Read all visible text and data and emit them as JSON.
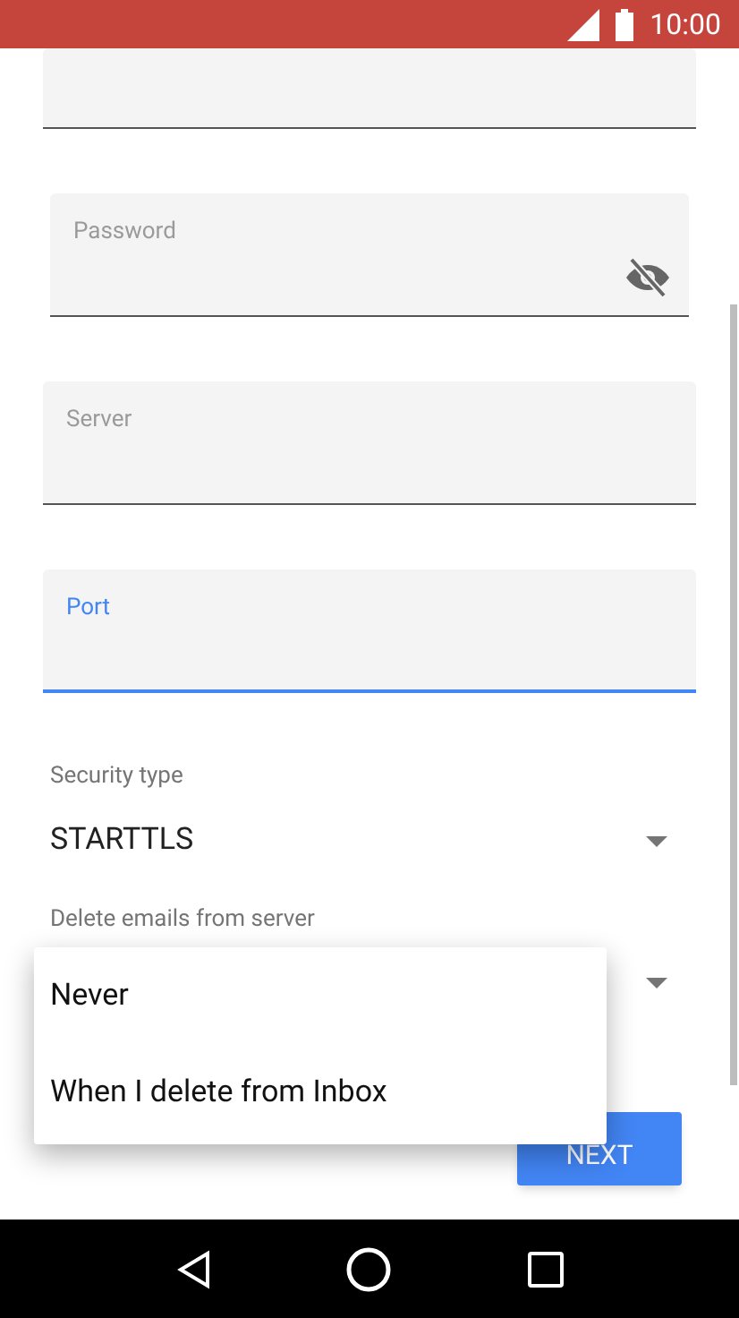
{
  "status_bar": {
    "time": "10:00"
  },
  "fields": [
    {
      "kind": "text",
      "focused": false
    },
    {
      "kind": "password",
      "label": "Password",
      "focused": false
    },
    {
      "kind": "text",
      "label": "Server",
      "focused": false
    },
    {
      "kind": "text",
      "label": "Port",
      "focused": true
    }
  ],
  "selects": [
    {
      "label": "Security type",
      "value": "STARTTLS"
    },
    {
      "label": "Delete emails from server"
    }
  ],
  "menu": {
    "options": [
      "Never",
      "When I delete from Inbox"
    ]
  },
  "next_button": {
    "label": "NEXT"
  }
}
